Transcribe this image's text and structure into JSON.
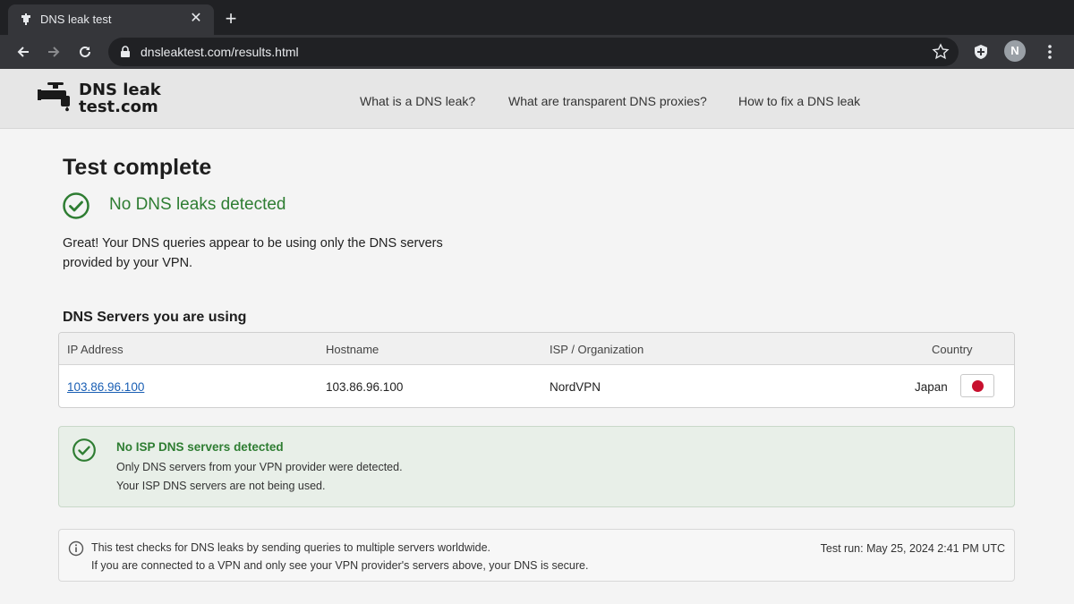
{
  "browser": {
    "tab_title": "DNS leak test",
    "url": "dnsleaktest.com/results.html",
    "profile_initial": "N"
  },
  "site": {
    "logo_line1": "DNS leak",
    "logo_line2": "test.com",
    "nav": [
      "What is a DNS leak?",
      "What are transparent DNS proxies?",
      "How to fix a DNS leak"
    ]
  },
  "result": {
    "title": "Test complete",
    "status": "No DNS leaks detected",
    "description": "Great! Your DNS queries appear to be using only the DNS servers provided by your VPN."
  },
  "dns_servers": {
    "section_title": "DNS Servers you are using",
    "columns": [
      "IP Address",
      "Hostname",
      "ISP / Organization",
      "Country"
    ],
    "rows": [
      {
        "ip": "103.86.96.100",
        "hostname": "103.86.96.100",
        "isp": "NordVPN",
        "country": "Japan"
      }
    ]
  },
  "isp_check": {
    "title": "No ISP DNS servers detected",
    "line1": "Only DNS servers from your VPN provider were detected.",
    "line2": "Your ISP DNS servers are not being used."
  },
  "info": {
    "line1": "This test checks for DNS leaks by sending queries to multiple servers worldwide.",
    "line2": "If you are connected to a VPN and only see your VPN provider's servers above, your DNS is secure.",
    "test_run": "Test run: May 25, 2024 2:41 PM UTC"
  },
  "colors": {
    "success": "#2e7d32",
    "link": "#1a5fb4",
    "flag_red": "#c8102e"
  },
  "icons": {
    "favicon": "faucet-icon",
    "status": "check-circle-icon",
    "info": "info-circle-icon"
  }
}
